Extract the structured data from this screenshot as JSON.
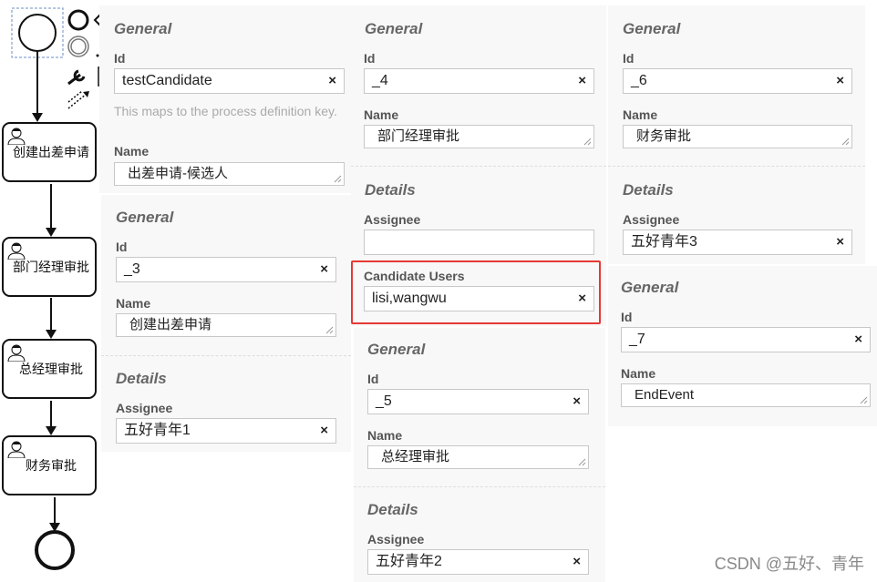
{
  "diagram": {
    "tasks": [
      "创建出差申请",
      "部门经理审批",
      "总经理审批",
      "财务审批"
    ]
  },
  "panels": {
    "process": {
      "general_title": "General",
      "id_label": "Id",
      "id_value": "testCandidate",
      "hint": "This maps to the process definition key.",
      "name_label": "Name",
      "name_value": "出差申请-候选人"
    },
    "task3": {
      "general_title": "General",
      "id_label": "Id",
      "id_value": "_3",
      "name_label": "Name",
      "name_value": "创建出差申请",
      "details_title": "Details",
      "assignee_label": "Assignee",
      "assignee_value": "五好青年1"
    },
    "task4": {
      "general_title": "General",
      "id_label": "Id",
      "id_value": "_4",
      "name_label": "Name",
      "name_value": "部门经理审批",
      "details_title": "Details",
      "assignee_label": "Assignee",
      "assignee_value": "",
      "candidate_label": "Candidate Users",
      "candidate_value": "lisi,wangwu"
    },
    "task5": {
      "general_title": "General",
      "id_label": "Id",
      "id_value": "_5",
      "name_label": "Name",
      "name_value": "总经理审批",
      "details_title": "Details",
      "assignee_label": "Assignee",
      "assignee_value": "五好青年2"
    },
    "task6": {
      "general_title": "General",
      "id_label": "Id",
      "id_value": "_6",
      "name_label": "Name",
      "name_value": "财务审批",
      "details_title": "Details",
      "assignee_label": "Assignee",
      "assignee_value": "五好青年3"
    },
    "end": {
      "general_title": "General",
      "id_label": "Id",
      "id_value": "_7",
      "name_label": "Name",
      "name_value": "EndEvent"
    }
  },
  "clear_glyph": "×",
  "watermark": "CSDN @五好、青年"
}
